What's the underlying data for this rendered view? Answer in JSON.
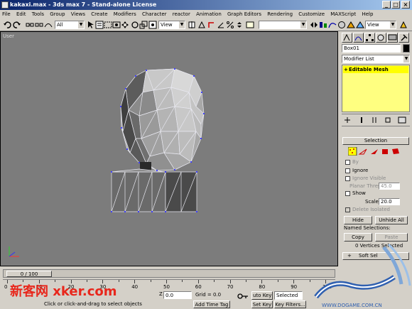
{
  "window": {
    "title": "kakaxi.max - 3ds max 7 - Stand-alone License"
  },
  "menu": [
    "File",
    "Edit",
    "Tools",
    "Group",
    "Views",
    "Create",
    "Modifiers",
    "Character",
    "reactor",
    "Animation",
    "Graph Editors",
    "Rendering",
    "Customize",
    "MAXScript",
    "Help"
  ],
  "toolbar": {
    "selection_filter": "All",
    "ref_coord": "View",
    "named_sel": "",
    "render_view": "View"
  },
  "viewport": {
    "label": "User"
  },
  "command_panel": {
    "object_name": "Box01",
    "object_color": "#000000",
    "modifier_list": "Modifier List",
    "stack_item": "Editable Mesh",
    "selection_rollout": "Selection",
    "by_vertex": "By",
    "ignore_backfacing": "Ignore",
    "ignore_visible": "Ignore Visible",
    "planar_thresh_label": "Planar Thresh",
    "planar_thresh_value": "45.0",
    "show_normals": "Show",
    "scale_label": "Scale",
    "scale_value": "20.0",
    "delete_isolated": "Delete Isolated",
    "hide": "Hide",
    "unhide_all": "Unhide All",
    "named_selections": "Named Selections:",
    "copy": "Copy",
    "paste": "Paste",
    "vertices_selected": "0 Vertices Selected",
    "soft_selection": "Soft Sel"
  },
  "timeline": {
    "slider_text": "0 / 100",
    "ticks": [
      "0",
      "10",
      "20",
      "30",
      "40",
      "50",
      "60",
      "70",
      "80",
      "90",
      "100"
    ]
  },
  "status": {
    "z_label": "Z",
    "z_value": "0.0",
    "grid": "Grid = 0.0",
    "auto_key": "uto Key",
    "selected": "Selected",
    "set_key": "Set Key",
    "key_filters": "Key Filters...",
    "add_time_tag": "Add Time Tag",
    "prompt": "Click or click-and-drag to select objects"
  },
  "watermarks": {
    "left": "新客网 xker.com",
    "right_url": "WWW.DOGAME.COM.CN"
  },
  "colors": {
    "accent": "#ffff00",
    "title_start": "#0a246a",
    "title_end": "#a6caf0",
    "wire": "#ffffff",
    "vertex": "#4040ff"
  }
}
